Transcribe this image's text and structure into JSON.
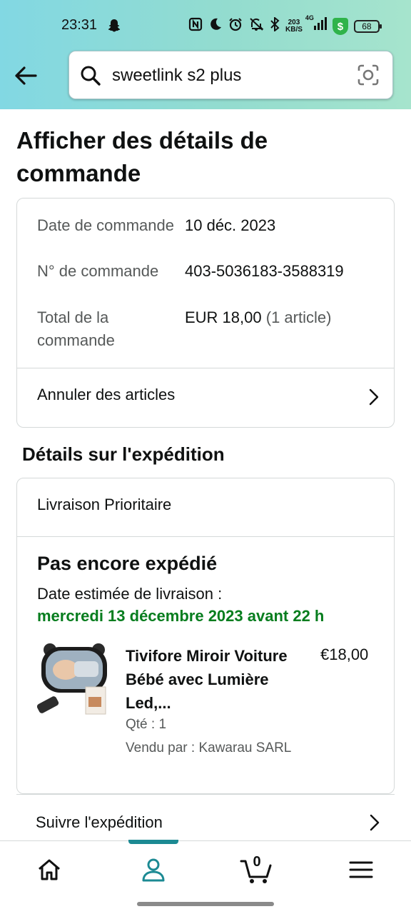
{
  "status_bar": {
    "time": "23:31",
    "network_speed_top": "203",
    "network_speed_unit": "KB/S",
    "network_type": "4G",
    "shield_label": "$",
    "battery": "68",
    "icons": [
      "snapchat-icon",
      "nfc-icon",
      "moon-icon",
      "alarm-icon",
      "mute-icon",
      "bluetooth-icon",
      "signal-icon",
      "shield-icon",
      "battery-icon"
    ]
  },
  "search": {
    "value": "sweetlink s2 plus"
  },
  "page": {
    "title": "Afficher des détails de commande"
  },
  "order_summary": {
    "rows": [
      {
        "label": "Date de commande",
        "value": "10 déc. 2023"
      },
      {
        "label": "N° de commande",
        "value": "403-5036183-3588319"
      },
      {
        "label": "Total de la commande",
        "value": "EUR 18,00",
        "extra": "(1 article)"
      }
    ],
    "cancel_label": "Annuler des articles"
  },
  "shipping": {
    "section_title": "Détails sur l'expédition",
    "method": "Livraison Prioritaire",
    "status": "Pas encore expédié",
    "estimated_label": "Date estimée de livraison :",
    "estimated_date": "mercredi 13 décembre 2023 avant 22 h",
    "estimated_date_color": "#067d1e",
    "product": {
      "title": "Tivifore Miroir Voiture Bébé avec Lumière Led,...",
      "price": "€18,00",
      "quantity": "Qté : 1",
      "seller": "Vendu par : Kawarau SARL"
    },
    "track_label": "Suivre l'expédition"
  },
  "bottom_nav": {
    "items": [
      "home-icon",
      "account-icon",
      "cart-icon",
      "menu-icon"
    ],
    "active": "account-icon",
    "active_color": "#1c8a93",
    "cart_count": "0"
  }
}
